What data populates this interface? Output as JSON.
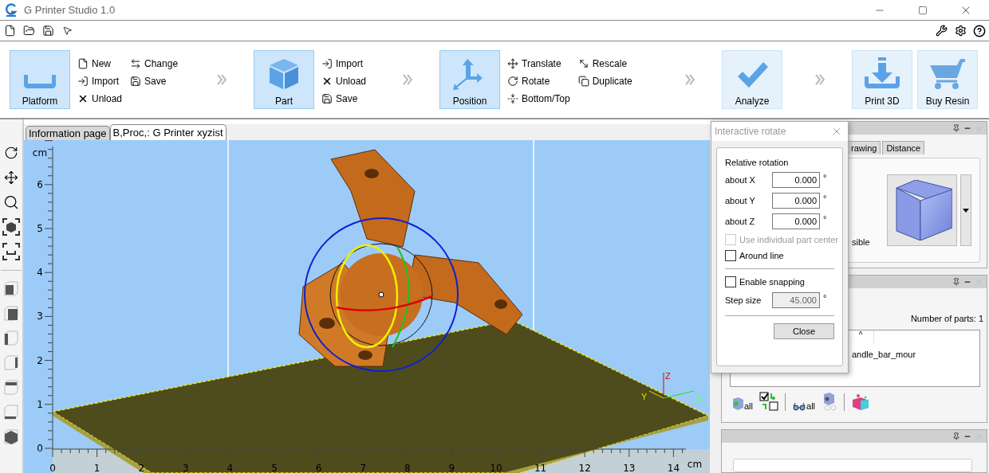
{
  "window": {
    "title": "G Printer Studio 1.0"
  },
  "ribbon": {
    "groups": [
      {
        "button": {
          "label": "Platform",
          "selected": true
        },
        "columns": [
          [
            "New",
            "Import",
            "Unload"
          ],
          [
            "Change",
            "Save"
          ]
        ]
      },
      {
        "button": {
          "label": "Part",
          "selected": true
        },
        "columns": [
          [
            "Import",
            "Unload",
            "Save"
          ]
        ]
      },
      {
        "button": {
          "label": "Position",
          "selected": true
        },
        "columns": [
          [
            "Translate",
            "Rotate",
            "Bottom/Top"
          ],
          [
            "Rescale",
            "Duplicate"
          ]
        ]
      },
      {
        "button": {
          "label": "Analyze",
          "selected": false
        }
      }
    ],
    "end_buttons": [
      {
        "label": "Print 3D",
        "selected": false
      },
      {
        "label": "Buy Resin",
        "selected": false
      }
    ]
  },
  "viewport": {
    "tabs": [
      {
        "label": "Information page",
        "selected": false
      },
      {
        "label": "B,Proc,: G Printer xyzist",
        "selected": true
      }
    ],
    "y_ruler": {
      "unit": "cm",
      "labels": [
        "6",
        "5",
        "4",
        "3",
        "2",
        "1",
        "0"
      ]
    },
    "x_ruler": {
      "unit": "cm",
      "labels": [
        "0",
        "1",
        "2",
        "3",
        "4",
        "5",
        "6",
        "7",
        "8",
        "9",
        "10",
        "11",
        "12",
        "13",
        "14"
      ]
    },
    "axes": {
      "x": "X",
      "y": "Y",
      "z": "Z"
    }
  },
  "dialog": {
    "title": "Interactive rotate",
    "section": "Relative rotation",
    "fields": [
      {
        "label": "about X",
        "value": "0.000",
        "unit": "°"
      },
      {
        "label": "about Y",
        "value": "0.000",
        "unit": "°"
      },
      {
        "label": "about Z",
        "value": "0.000",
        "unit": "°"
      }
    ],
    "options": [
      {
        "label": "Use individual part center",
        "checked": false,
        "disabled": true
      },
      {
        "label": "Around line",
        "checked": false,
        "disabled": false
      }
    ],
    "snapping": {
      "label": "Enable snapping",
      "checked": false
    },
    "step": {
      "label": "Step size",
      "value": "45.000",
      "unit": "°",
      "disabled": true
    },
    "close_button": "Close"
  },
  "view_panel": {
    "tabs": [
      {
        "label": "rawing",
        "selected": false
      },
      {
        "label": "Distance",
        "selected": false
      }
    ],
    "visibility_text": "sible"
  },
  "parts_panel": {
    "count": "Number of parts: 1",
    "list": {
      "header": "^",
      "items": [
        "andle_bar_mour"
      ]
    },
    "tool_labels": [
      "all",
      "all"
    ]
  }
}
